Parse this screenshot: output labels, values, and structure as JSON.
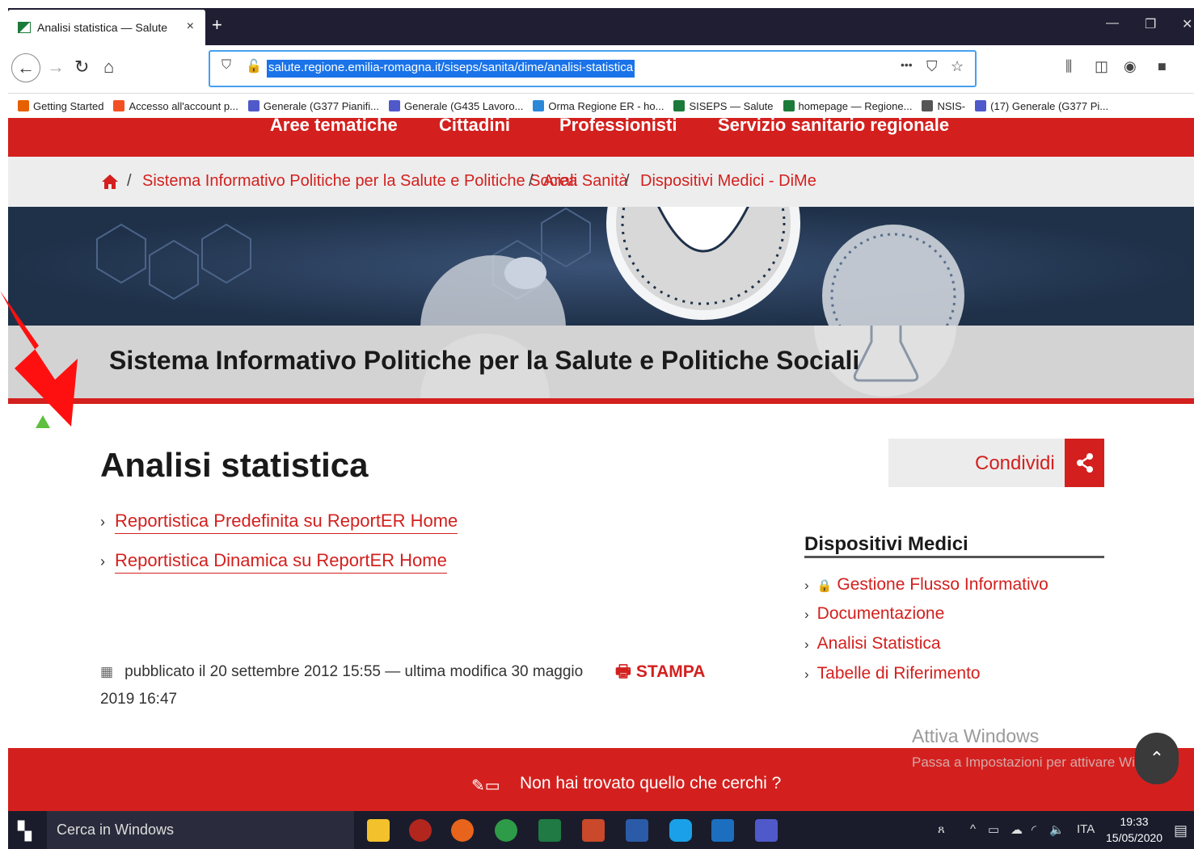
{
  "browser": {
    "tab_title": "Analisi statistica — Salute",
    "tab_close": "×",
    "new_tab": "+",
    "url": "salute.regione.emilia-romagna.it/siseps/sanita/dime/analisi-statistica",
    "url_more": "•••",
    "bookmarks": [
      {
        "label": "Getting Started",
        "color": "#e66000"
      },
      {
        "label": "Accesso all'account p...",
        "color": "#f25022"
      },
      {
        "label": "Generale (G377 Pianifi...",
        "color": "#5059c9"
      },
      {
        "label": "Generale (G435 Lavoro...",
        "color": "#5059c9"
      },
      {
        "label": "Orma Regione ER - ho...",
        "color": "#2b88d8"
      },
      {
        "label": "SISEPS — Salute",
        "color": "#1b7a3a"
      },
      {
        "label": "homepage — Regione...",
        "color": "#1b7a3a"
      },
      {
        "label": "NSIS-",
        "color": "#555555"
      },
      {
        "label": "(17) Generale (G377 Pi...",
        "color": "#5059c9"
      }
    ]
  },
  "site": {
    "topnav": [
      "Aree tematiche",
      "Cittadini",
      "Professionisti",
      "Servizio sanitario regionale"
    ],
    "breadcrumb": [
      "Sistema Informativo Politiche per la Salute e Politiche Sociali",
      "Area Sanità",
      "Dispositivi Medici - DiMe"
    ],
    "breadcrumb_sep": "/",
    "hero_title": "Sistema Informativo Politiche per la Salute e Politiche Sociali",
    "page_title": "Analisi statistica",
    "links": [
      "Reportistica Predefinita su ReportER Home",
      "Reportistica Dinamica su ReportER Home"
    ],
    "share_label": "Condividi",
    "sidebar": {
      "title": "Dispositivi Medici",
      "items": [
        "Gestione Flusso Informativo",
        "Documentazione",
        "Analisi Statistica",
        "Tabelle di Riferimento"
      ]
    },
    "published_line1": "pubblicato il 20 settembre 2012 15:55 —   ultima modifica 30 maggio",
    "published_line2": "2019 16:47",
    "print_label": "STAMPA",
    "watermark_title": "Attiva Windows",
    "watermark_sub": "Passa a Impostazioni per attivare Windows.",
    "footer_text": "Non hai trovato quello che cerchi ?"
  },
  "taskbar": {
    "search_placeholder": "Cerca in Windows",
    "lang": "ITA",
    "time": "19:33",
    "date": "15/05/2020"
  },
  "colors": {
    "brand_red": "#d3201e",
    "hero_navy": "#1f3149",
    "url_highlight": "#1a73e8"
  }
}
